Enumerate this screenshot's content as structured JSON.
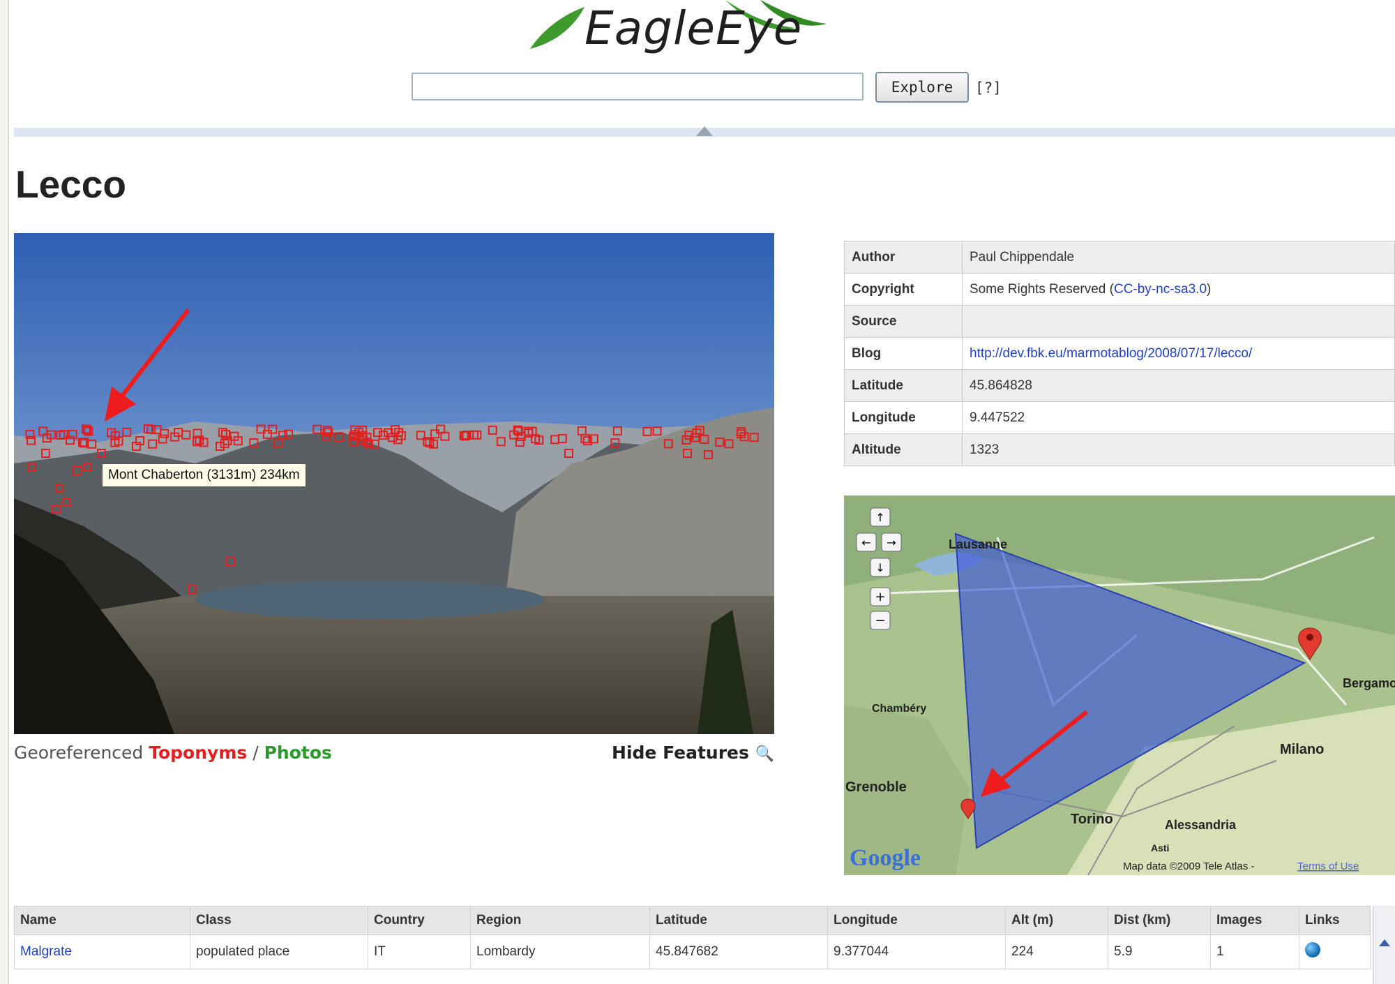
{
  "header": {
    "logo_text": "EagleEye",
    "search_value": "",
    "explore_label": "Explore",
    "help_label": "[?]"
  },
  "page": {
    "title": "Lecco"
  },
  "photo": {
    "tooltip": "Mont Chaberton (3131m) 234km",
    "features_label": "Georeferenced",
    "toponyms_label": "Toponyms",
    "separator": "/",
    "photos_label": "Photos",
    "hide_features_label": "Hide Features",
    "marker_color": "#e02020"
  },
  "info": {
    "rows": [
      {
        "key": "Author",
        "value": "Paul Chippendale"
      },
      {
        "key": "Copyright",
        "value": "Some Rights Reserved (",
        "link": "CC-by-nc-sa3.0",
        "suffix": ")"
      },
      {
        "key": "Source",
        "value": ""
      },
      {
        "key": "Blog",
        "link": "http://dev.fbk.eu/marmotablog/2008/07/17/lecco/"
      },
      {
        "key": "Latitude",
        "value": "45.864828"
      },
      {
        "key": "Longitude",
        "value": "9.447522"
      },
      {
        "key": "Altitude",
        "value": "1323"
      }
    ]
  },
  "map": {
    "labels": [
      "Lausanne",
      "Chambéry",
      "Grenoble",
      "Torino",
      "Alessandria",
      "Milano",
      "Bergamo",
      "Asti"
    ],
    "brand": "Google",
    "copyright": "Map data ©2009 Tele Atlas -",
    "terms": "Terms of Use",
    "viewshed_color": "#3a56d8"
  },
  "results": {
    "columns": [
      "Name",
      "Class",
      "Country",
      "Region",
      "Latitude",
      "Longitude",
      "Alt (m)",
      "Dist (km)",
      "Images",
      "Links"
    ],
    "rows": [
      {
        "name": "Malgrate",
        "class": "populated place",
        "country": "IT",
        "region": "Lombardy",
        "lat": "45.847682",
        "lon": "9.377044",
        "alt": "224",
        "dist": "5.9",
        "images": "1"
      }
    ]
  }
}
